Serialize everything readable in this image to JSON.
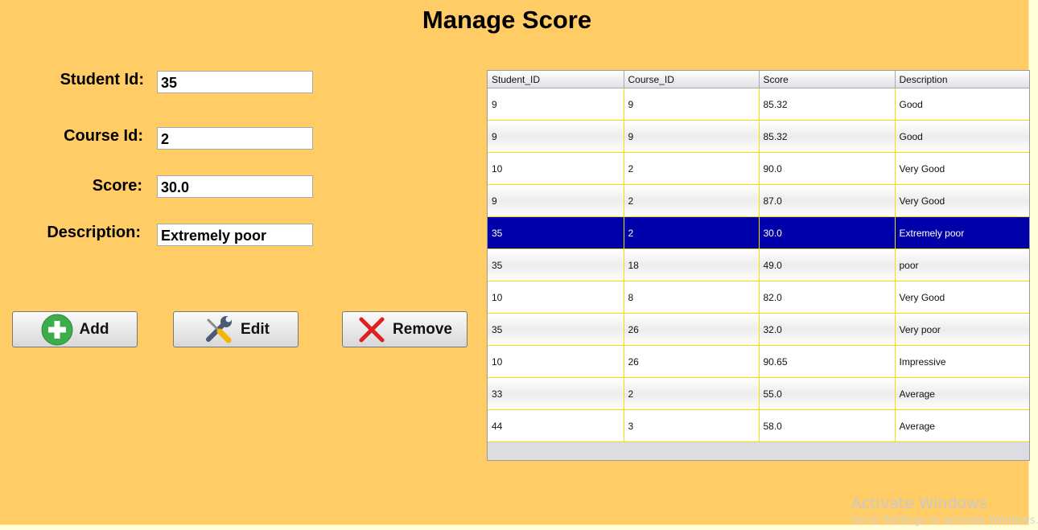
{
  "window": {
    "title": "Manage Score"
  },
  "form": {
    "student_id_label": "Student Id:",
    "student_id_value": "35",
    "course_id_label": "Course Id:",
    "course_id_value": "2",
    "score_label": "Score:",
    "score_value": "30.0",
    "description_label": "Description:",
    "description_value": "Extremely poor"
  },
  "buttons": {
    "add_label": "Add",
    "add_icon": "plus-circle-icon",
    "edit_label": "Edit",
    "edit_icon": "tools-icon",
    "remove_label": "Remove",
    "remove_icon": "red-x-icon"
  },
  "table": {
    "columns": [
      "Student_ID",
      "Course_ID",
      "Score",
      "Description"
    ],
    "selected_row_index": 4,
    "rows": [
      [
        "9",
        "9",
        "85.32",
        "Good"
      ],
      [
        "9",
        "9",
        "85.32",
        "Good"
      ],
      [
        "10",
        "2",
        "90.0",
        "Very Good"
      ],
      [
        "9",
        "2",
        "87.0",
        "Very Good"
      ],
      [
        "35",
        "2",
        "30.0",
        "Extremely poor"
      ],
      [
        "35",
        "18",
        "49.0",
        "poor"
      ],
      [
        "10",
        "8",
        "82.0",
        "Very Good"
      ],
      [
        "35",
        "26",
        "32.0",
        "Very poor"
      ],
      [
        "10",
        "26",
        "90.65",
        "Impressive"
      ],
      [
        "33",
        "2",
        "55.0",
        "Average"
      ],
      [
        "44",
        "3",
        "58.0",
        "Average"
      ]
    ]
  },
  "watermark": {
    "title": "Activate Windows",
    "subtitle": "Go to Settings to activate Windows."
  },
  "colors": {
    "background": "#ffcc66",
    "selection": "#0000aa",
    "grid_line": "#f2e000"
  }
}
